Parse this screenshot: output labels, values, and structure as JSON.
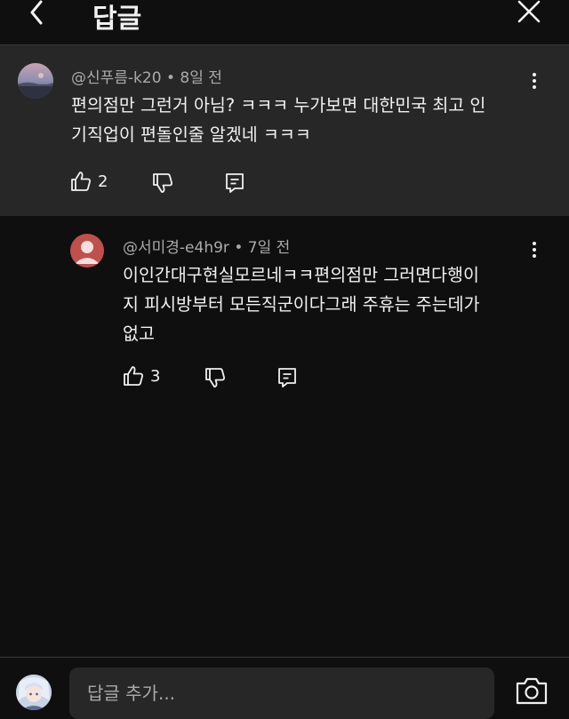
{
  "header": {
    "title": "답글"
  },
  "parent_comment": {
    "author": "@신푸름-k20",
    "time": "8일 전",
    "text": "편의점만 그런거 아님? ㅋㅋㅋ 누가보면 대한민국 최고 인\n기직업이 편돌인줄 알겠네 ㅋㅋㅋ",
    "likes": "2"
  },
  "reply_comment": {
    "author": "@서미경-e4h9r",
    "time": "7일 전",
    "text": "이인간대구현실모르네ㅋㅋ편의점만 그러면다행이\n지  피시방부터 모든직군이다그래  주휴는 주는데가\n없고",
    "likes": "3"
  },
  "reply_input": {
    "placeholder": "답글 추가..."
  },
  "colors": {
    "background": "#0f0f0f",
    "highlight": "#272727",
    "text": "#f1f1f1",
    "secondary_text": "#aaaaaa",
    "reply_avatar": "#c0504d"
  },
  "icons": [
    "back-arrow-icon",
    "close-icon",
    "like-icon",
    "dislike-icon",
    "reply-icon",
    "more-vert-icon",
    "camera-icon"
  ]
}
